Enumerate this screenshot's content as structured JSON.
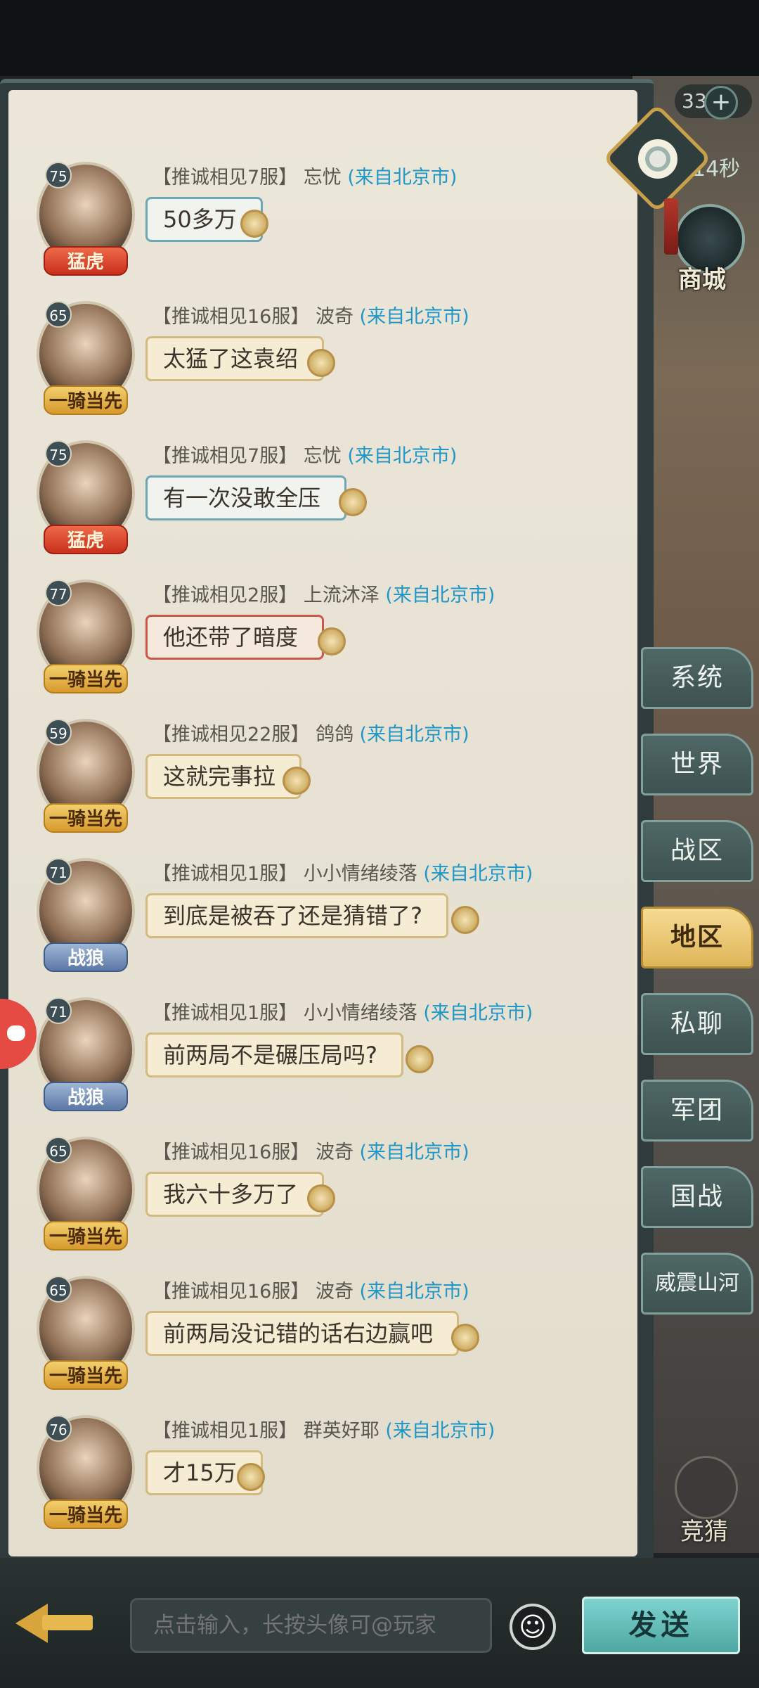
{
  "right_panel": {
    "counter": "33",
    "timer": "14秒",
    "shop_label": "商城",
    "guess_label": "竞猜"
  },
  "messages": [
    {
      "level": "75",
      "badge": "猛虎",
      "server": "【推诚相见7服】",
      "name": "忘忧",
      "location": "(来自北京市)",
      "text": "50多万"
    },
    {
      "level": "65",
      "badge": "一骑当先",
      "server": "【推诚相见16服】",
      "name": "波奇",
      "location": "(来自北京市)",
      "text": "太猛了这袁绍"
    },
    {
      "level": "75",
      "badge": "猛虎",
      "server": "【推诚相见7服】",
      "name": "忘忧",
      "location": "(来自北京市)",
      "text": "有一次没敢全压"
    },
    {
      "level": "77",
      "badge": "一骑当先",
      "server": "【推诚相见2服】",
      "name": "上流沐泽",
      "location": "(来自北京市)",
      "text": "他还带了暗度"
    },
    {
      "level": "59",
      "badge": "一骑当先",
      "server": "【推诚相见22服】",
      "name": "鸽鸽",
      "location": "(来自北京市)",
      "text": "这就完事拉"
    },
    {
      "level": "71",
      "badge": "战狼",
      "server": "【推诚相见1服】",
      "name": "小小情绪绫落",
      "location": "(来自北京市)",
      "text": "到底是被吞了还是猜错了?"
    },
    {
      "level": "71",
      "badge": "战狼",
      "server": "【推诚相见1服】",
      "name": "小小情绪绫落",
      "location": "(来自北京市)",
      "text": "前两局不是碾压局吗?"
    },
    {
      "level": "65",
      "badge": "一骑当先",
      "server": "【推诚相见16服】",
      "name": "波奇",
      "location": "(来自北京市)",
      "text": "我六十多万了"
    },
    {
      "level": "65",
      "badge": "一骑当先",
      "server": "【推诚相见16服】",
      "name": "波奇",
      "location": "(来自北京市)",
      "text": "前两局没记错的话右边赢吧"
    },
    {
      "level": "76",
      "badge": "一骑当先",
      "server": "【推诚相见1服】",
      "name": "群英好耶",
      "location": "(来自北京市)",
      "text": "才15万"
    }
  ],
  "tabs": [
    {
      "label": "系统"
    },
    {
      "label": "世界"
    },
    {
      "label": "战区"
    },
    {
      "label": "地区"
    },
    {
      "label": "私聊"
    },
    {
      "label": "军团"
    },
    {
      "label": "国战"
    },
    {
      "label": "威震山河"
    }
  ],
  "input": {
    "placeholder": "点击输入，长按头像可@玩家"
  },
  "send_label": "发送"
}
